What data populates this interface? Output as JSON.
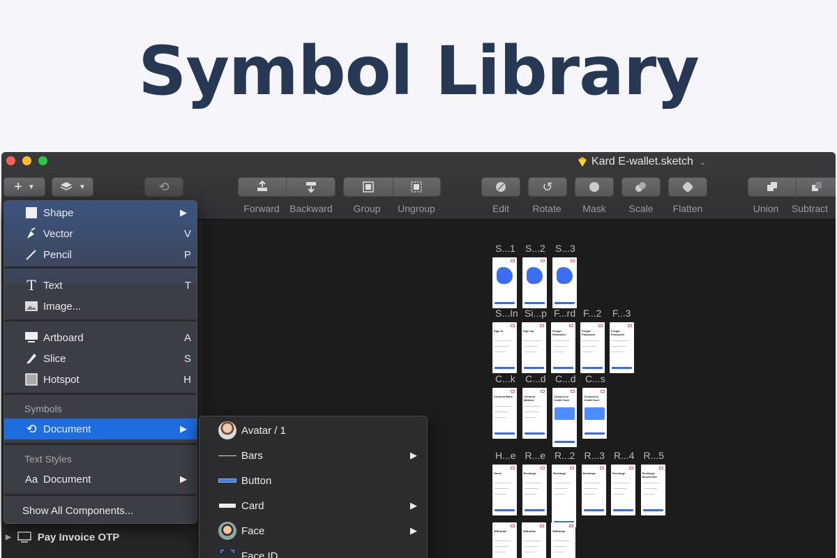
{
  "hero": {
    "title": "Symbol Library"
  },
  "window": {
    "doc_title": "Kard E-wallet.sketch"
  },
  "toolbar": {
    "buttons": [
      {
        "label": "Forward",
        "icon": "forward-icon"
      },
      {
        "label": "Backward",
        "icon": "backward-icon"
      },
      {
        "label": "Group",
        "icon": "group-icon"
      },
      {
        "label": "Ungroup",
        "icon": "ungroup-icon"
      },
      {
        "label": "Edit",
        "icon": "edit-icon"
      },
      {
        "label": "Rotate",
        "icon": "rotate-icon"
      },
      {
        "label": "Mask",
        "icon": "mask-icon"
      },
      {
        "label": "Scale",
        "icon": "scale-icon"
      },
      {
        "label": "Flatten",
        "icon": "flatten-icon"
      },
      {
        "label": "Union",
        "icon": "union-icon"
      },
      {
        "label": "Subtract",
        "icon": "subtract-icon"
      }
    ]
  },
  "insert_menu": {
    "items": [
      {
        "label": "Shape",
        "key": "",
        "arrow": "▶",
        "icon": "square-icon"
      },
      {
        "label": "Vector",
        "key": "V",
        "icon": "pen-icon"
      },
      {
        "label": "Pencil",
        "key": "P",
        "icon": "pencil-icon"
      },
      {
        "label": "Text",
        "key": "T",
        "icon": "text-icon"
      },
      {
        "label": "Image...",
        "key": "",
        "icon": "image-icon"
      },
      {
        "label": "Artboard",
        "key": "A",
        "icon": "artboard-icon"
      },
      {
        "label": "Slice",
        "key": "S",
        "icon": "slice-icon"
      },
      {
        "label": "Hotspot",
        "key": "H",
        "icon": "hotspot-icon"
      }
    ],
    "symbols_header": "Symbols",
    "symbols_document": "Document",
    "text_styles_header": "Text Styles",
    "text_styles_icon": "Aa",
    "text_styles_document": "Document",
    "show_all": "Show All Components..."
  },
  "submenu": {
    "items": [
      {
        "label": "Avatar / 1",
        "arrow": ""
      },
      {
        "label": "Bars",
        "arrow": "▶"
      },
      {
        "label": "Button",
        "arrow": ""
      },
      {
        "label": "Card",
        "arrow": "▶"
      },
      {
        "label": "Face",
        "arrow": "▶"
      },
      {
        "label": "Face ID",
        "arrow": ""
      }
    ]
  },
  "sidebar": {
    "layer_label": "Pay Invoice OTP"
  },
  "artboards": {
    "row1": [
      "S...1",
      "S...2",
      "S...3"
    ],
    "row2": [
      "S...In",
      "Si...p",
      "F...rd",
      "F...2",
      "F...3"
    ],
    "row3": [
      "C...k",
      "C...d",
      "C...d",
      "C...s"
    ],
    "row4": [
      "H...e",
      "R...e",
      "R...2",
      "R...3",
      "R...4",
      "R...5"
    ],
    "row2_titles": [
      "Sign In",
      "Sign Up",
      "Forgot Password",
      "Forgot Password",
      "Forgot Password"
    ],
    "row3_titles": [
      "Connect Bank",
      "Connect Method",
      "Connect to Credit Card",
      "Connect to Credit Card"
    ],
    "row4_titles": [
      "Home",
      "Recharge",
      "Recharge",
      "Recharge",
      "Recharge",
      "Recharge Successful"
    ],
    "row5_titles": [
      "Withdraw",
      "Withdraw",
      "Withdraw"
    ]
  },
  "colors": {
    "accent": "#1d6ce0",
    "hero_text": "#263854",
    "canvas": "#1c1c1c"
  }
}
